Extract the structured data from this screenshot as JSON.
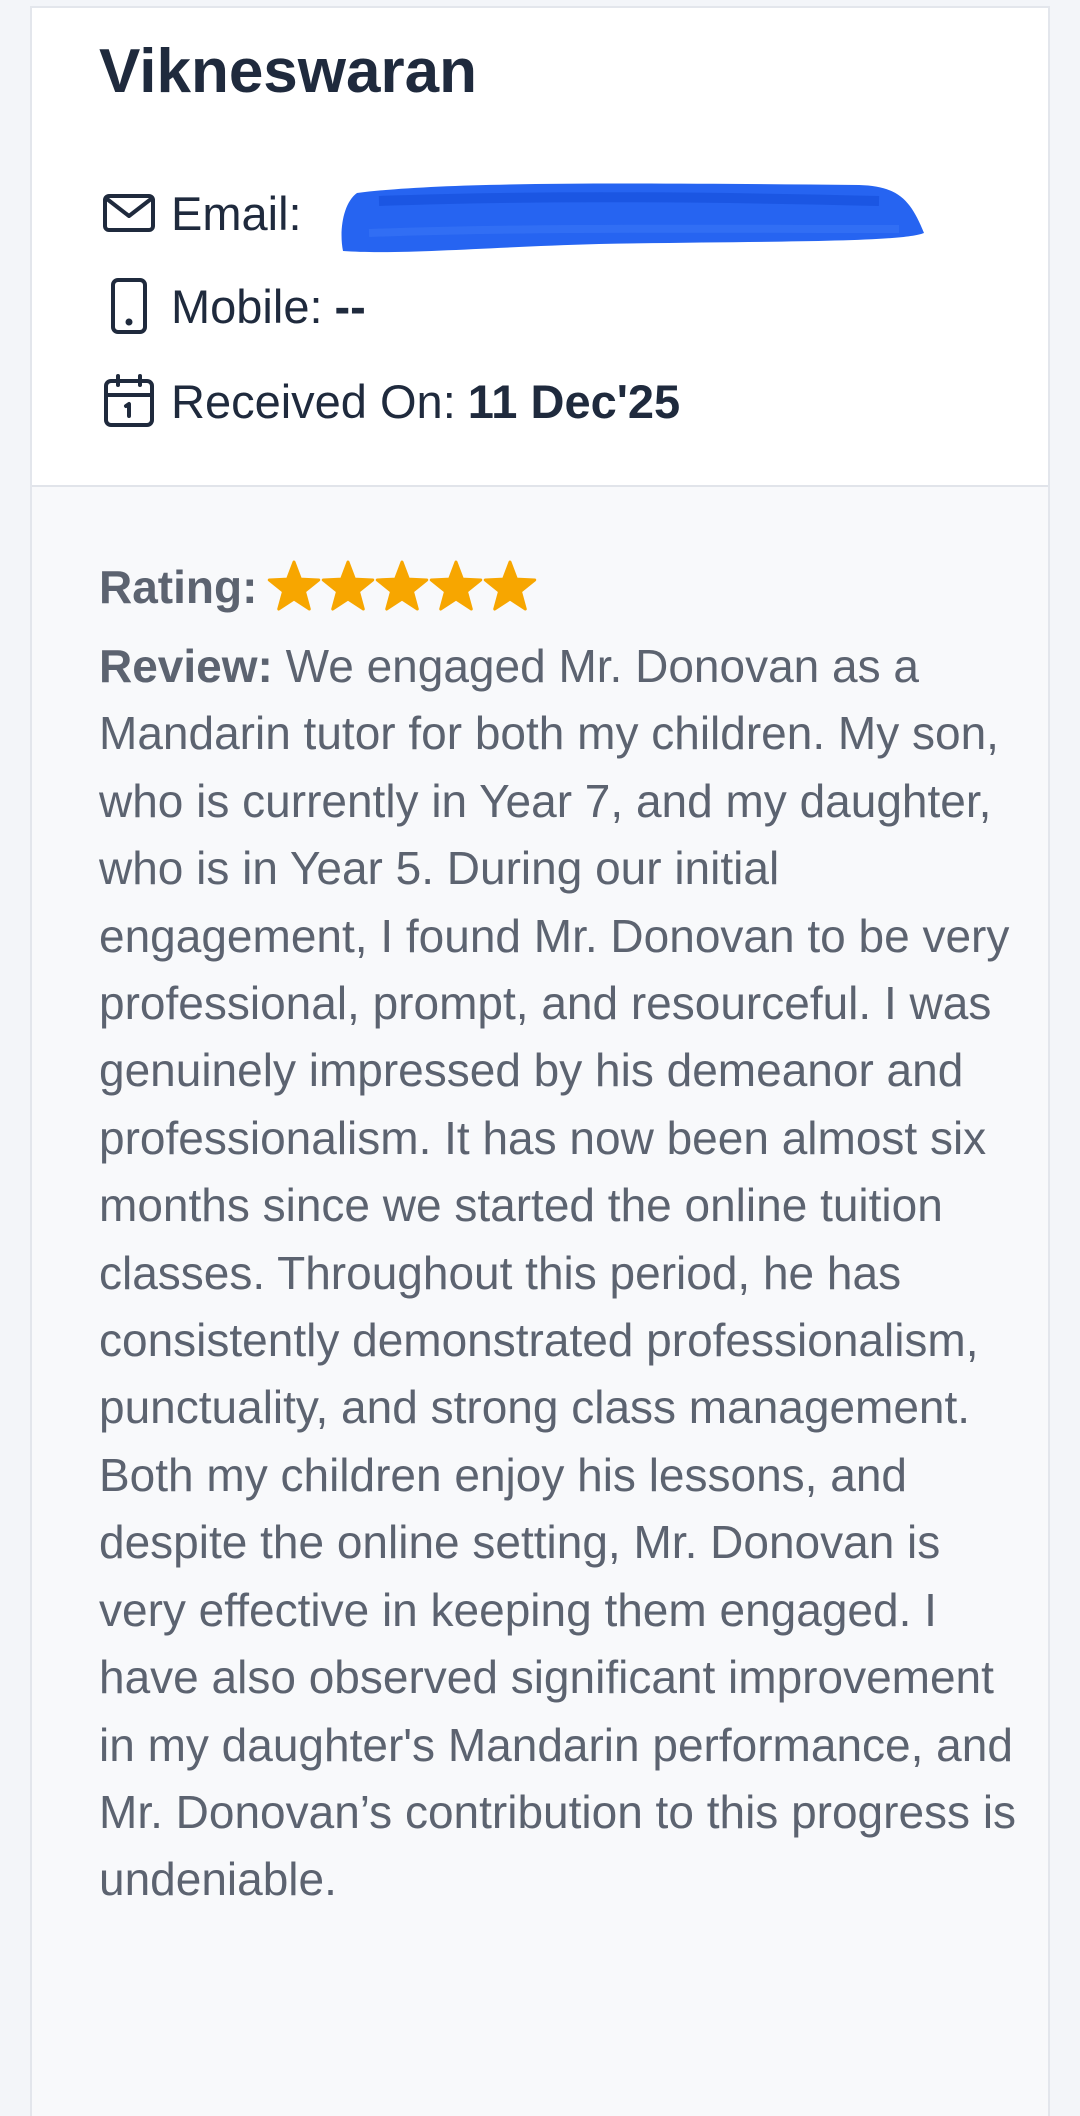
{
  "reviewer": {
    "name": "Vikneswaran"
  },
  "contact": {
    "email_label": "Email:",
    "mobile_label": "Mobile:",
    "mobile_value": "--",
    "received_label": "Received On:",
    "received_value": "11 Dec'25"
  },
  "icons": {
    "email": "envelope-icon",
    "mobile": "phone-icon",
    "received": "calendar-icon",
    "star": "star-icon"
  },
  "rating": {
    "label": "Rating:",
    "stars": 5,
    "max": 5,
    "star_color": "#f7a600"
  },
  "review": {
    "label": "Review:",
    "text": "We engaged Mr. Donovan as a Mandarin tutor for both my children. My son, who is currently in Year 7, and my daughter, who is in Year 5. During our initial engagement, I found Mr. Donovan to be very professional, prompt, and resourceful. I was genuinely impressed by his demeanor and professionalism. It has now been almost six months since we started the online tuition classes. Throughout this period, he has consistently demonstrated professionalism, punctuality, and strong class management. Both my children enjoy his lessons, and despite the online setting, Mr. Donovan is very effective in keeping them engaged. I have also observed significant improvement in my daughter's Mandarin performance, and Mr. Donovan’s contribution to this progress is undeniable."
  },
  "colors": {
    "redaction": "#1a5cf0",
    "text_dark": "#1f2a3d",
    "text_muted": "#5c6370"
  }
}
